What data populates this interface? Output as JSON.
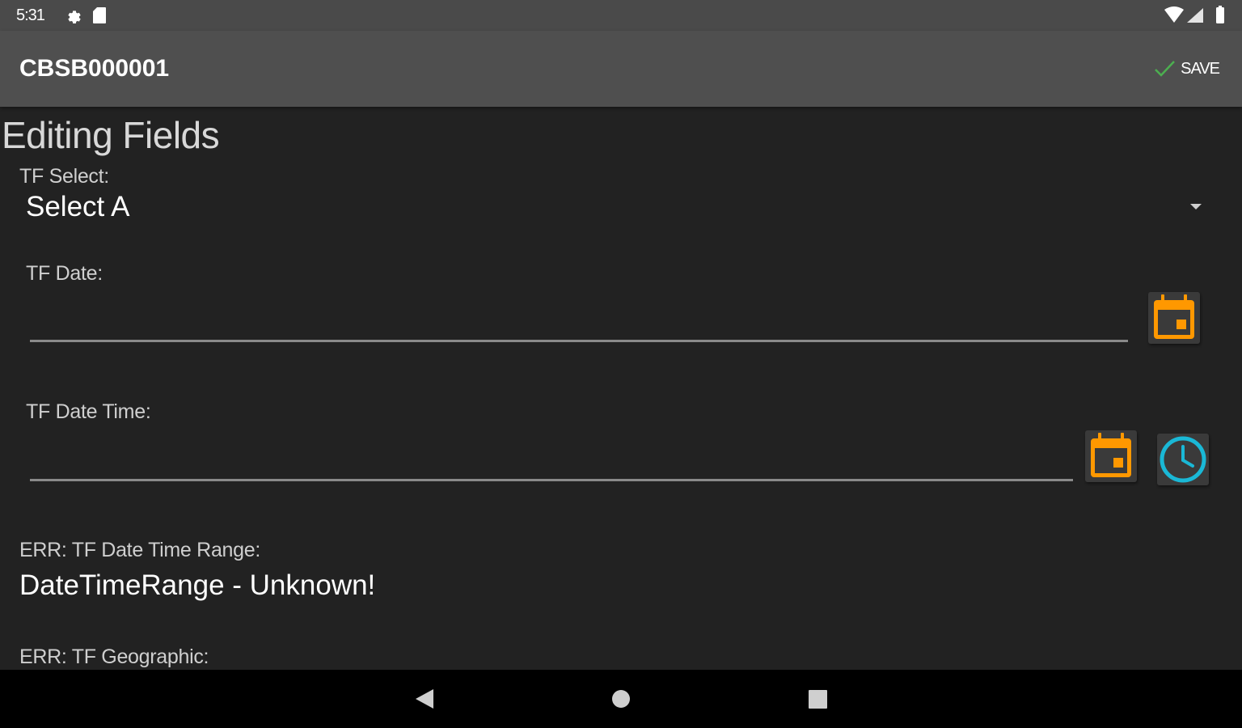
{
  "status_bar": {
    "time": "5:31",
    "icons": [
      "settings-icon",
      "sd-card-icon",
      "wifi-icon",
      "cell-signal-icon",
      "battery-icon"
    ]
  },
  "app_bar": {
    "title": "CBSB000001",
    "save_label": "SAVE",
    "save_icon": "check-icon",
    "save_icon_color": "#4caf50"
  },
  "page": {
    "heading": "Editing Fields"
  },
  "fields": {
    "tf_select": {
      "label": "TF Select:",
      "value": "Select A"
    },
    "tf_date": {
      "label": "TF Date:",
      "value": "",
      "calendar_icon": "calendar-icon",
      "calendar_color": "#ff9800"
    },
    "tf_date_time": {
      "label": "TF Date Time:",
      "value": "",
      "calendar_icon": "calendar-icon",
      "clock_icon": "clock-icon",
      "clock_color": "#1ab8d6"
    },
    "tf_date_time_range": {
      "label": "ERR: TF Date Time Range:",
      "value": "DateTimeRange - Unknown!"
    },
    "tf_geographic": {
      "label": "ERR: TF Geographic:"
    }
  },
  "nav_bar": {
    "buttons": [
      "back-icon",
      "home-icon",
      "recents-icon"
    ]
  }
}
